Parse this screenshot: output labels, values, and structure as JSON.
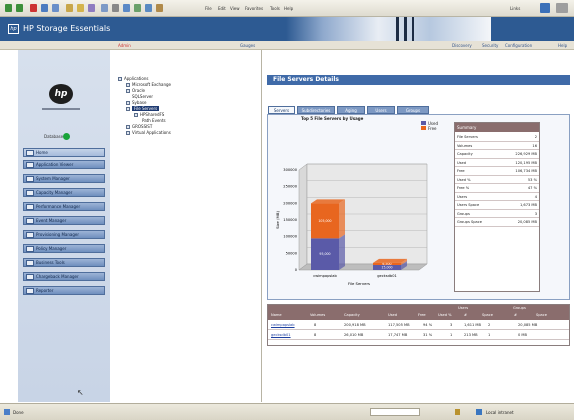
{
  "browser": {
    "menu": [
      "File",
      "Edit",
      "View",
      "Favorites",
      "Tools",
      "Help"
    ],
    "links_label": "Links"
  },
  "header": {
    "logo": "hp",
    "title": "HP Storage Essentials"
  },
  "topbar": {
    "user_label": "Admin",
    "status_label": "Gauges",
    "links": [
      "Discovery",
      "Security",
      "Configuration",
      "Help"
    ]
  },
  "sidebar": {
    "logo": "hp",
    "db_status": "Database",
    "nav": [
      "Home",
      "Application Viewer",
      "System Manager",
      "Capacity Manager",
      "Performance Manager",
      "Event Manager",
      "Provisioning Manager",
      "Policy Manager",
      "Business Tools",
      "Chargeback Manager",
      "Reporter"
    ]
  },
  "tree": {
    "items": [
      {
        "label": "Applications",
        "level": 0
      },
      {
        "label": "Microsoft Exchange",
        "level": 1
      },
      {
        "label": "Oracle",
        "level": 1
      },
      {
        "label": "SQLServer",
        "level": 1
      },
      {
        "label": "Sybase",
        "level": 1
      },
      {
        "label": "File Servers",
        "level": 1,
        "selected": true
      },
      {
        "label": "HPSharedFS",
        "level": 2
      },
      {
        "label": "Path Events",
        "level": 2
      },
      {
        "label": "GROSSIST",
        "level": 1
      },
      {
        "label": "Virtual Applications",
        "level": 1
      }
    ]
  },
  "main": {
    "title": "File Servers Details",
    "tabs": [
      "Servers",
      "Subdirectories",
      "Aging",
      "Users",
      "Groups"
    ],
    "active_tab": 0
  },
  "chart_data": {
    "type": "bar",
    "title": "Top 5 File Servers by Usage",
    "xlabel": "File Servers",
    "ylabel": "Size (MB)",
    "categories": [
      "cwimpapslab",
      "gecksdb01"
    ],
    "series": [
      {
        "name": "Used",
        "color": "#5a5aa8",
        "values": [
          95000,
          15000
        ]
      },
      {
        "name": "Free",
        "color": "#e8661f",
        "values": [
          105000,
          6500
        ]
      }
    ],
    "yticks": [
      "0",
      "50000",
      "100000",
      "150000",
      "200000",
      "250000",
      "300000"
    ],
    "ylim": [
      0,
      300000
    ],
    "legend_position": "top-right"
  },
  "summary": {
    "header": "Summary",
    "rows": [
      {
        "k": "File Servers",
        "v": "2"
      },
      {
        "k": "Volumes",
        "v": "16"
      },
      {
        "k": "Capacity",
        "v": "226,929 MB"
      },
      {
        "k": "Used",
        "v": "120,195 MB"
      },
      {
        "k": "Free",
        "v": "106,734 MB"
      },
      {
        "k": "Used %",
        "v": "53 %"
      },
      {
        "k": "Free %",
        "v": "47 %"
      },
      {
        "k": "Users",
        "v": "4"
      },
      {
        "k": "Users Space",
        "v": "1,673 MB"
      },
      {
        "k": "Groups",
        "v": "3"
      },
      {
        "k": "Groups Space",
        "v": "20,085 MB"
      }
    ]
  },
  "details": {
    "group_headers": [
      "Users",
      "Groups"
    ],
    "columns": [
      "Name",
      "Volumes",
      "Capacity",
      "Used",
      "Free",
      "Used %",
      "#",
      "Space",
      "#",
      "Space"
    ],
    "rows": [
      [
        "cwimpapslab",
        "8",
        "200,918 MB",
        "117,505 MB",
        "94 %",
        "3",
        "1,611 MB",
        "2",
        "20,085 MB"
      ],
      [
        "gecksdb01",
        "8",
        "26,010 MB",
        "17,747 MB",
        "31 %",
        "1",
        "213 MB",
        "1",
        "0 MB"
      ]
    ]
  },
  "status_bar": {
    "left": "Done",
    "right": "Local intranet"
  }
}
